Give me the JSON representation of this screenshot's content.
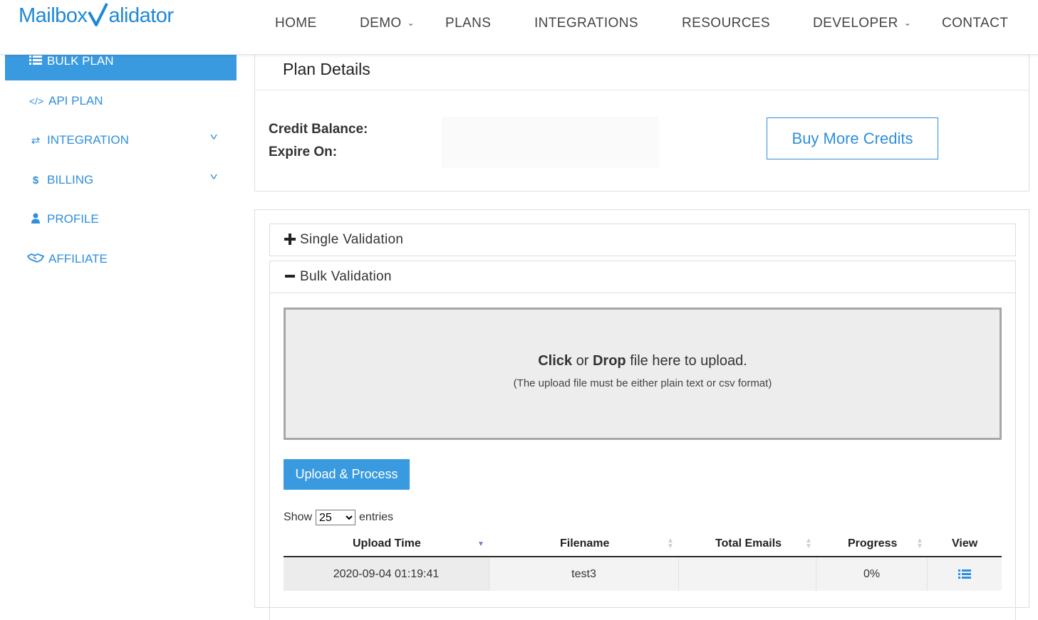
{
  "brand": {
    "name_part1": "Mailbox",
    "name_part2": "alidator"
  },
  "nav": {
    "home": "HOME",
    "demo": "DEMO",
    "plans": "PLANS",
    "integrations": "INTEGRATIONS",
    "resources": "RESOURCES",
    "developer": "DEVELOPER",
    "contact": "CONTACT",
    "caret": "⌄"
  },
  "sidebar": {
    "items": [
      {
        "label": "BULK PLAN",
        "icon": "list-icon"
      },
      {
        "label": "API PLAN",
        "icon": "code-icon"
      },
      {
        "label": "INTEGRATION",
        "icon": "exchange-icon"
      },
      {
        "label": "BILLING",
        "icon": "dollar-icon"
      },
      {
        "label": "PROFILE",
        "icon": "user-icon"
      },
      {
        "label": "AFFILIATE",
        "icon": "handshake-icon"
      }
    ]
  },
  "plan": {
    "title": "Plan Details",
    "credit_label": "Credit Balance:",
    "expire_label": "Expire On:",
    "buy_label": "Buy More Credits"
  },
  "validation": {
    "single_label": "Single Validation",
    "bulk_label": "Bulk Validation",
    "drop_click": "Click",
    "drop_or": "or",
    "drop_drop": "Drop",
    "drop_rest": "file here to upload.",
    "drop_note": "(The upload file must be either plain text or csv format)",
    "upload_label": "Upload & Process",
    "show_label": "Show",
    "entries_label": "entries",
    "page_size": "25",
    "columns": [
      "Upload Time",
      "Filename",
      "Total Emails",
      "Progress",
      "View"
    ],
    "rows": [
      {
        "upload_time": "2020-09-04 01:19:41",
        "filename": "test3",
        "total_emails": "",
        "progress": "0%"
      }
    ]
  },
  "colors": {
    "accent": "#3a9ae0",
    "link": "#2f8fdb"
  }
}
